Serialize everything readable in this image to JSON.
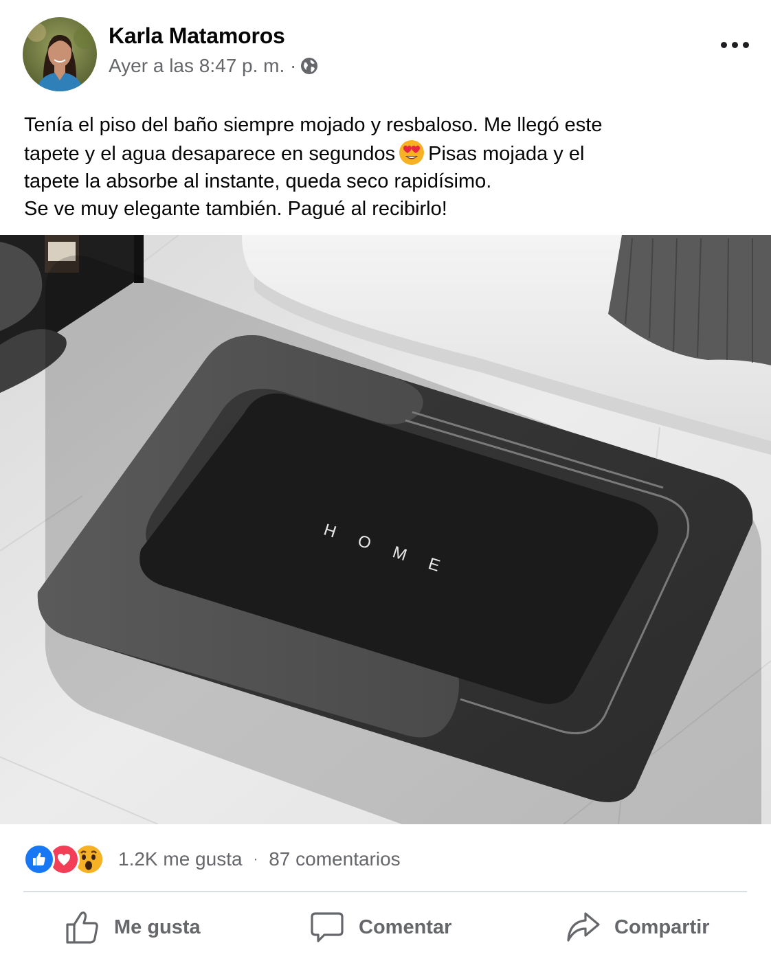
{
  "post": {
    "author_name": "Karla Matamoros",
    "time": "Ayer a las 8:47 p. m. ·",
    "text_lines": [
      "Tenía el piso del baño siempre mojado y resbaloso. Me llegó este",
      "tapete y el agua desaparece en segundos",
      "Pisas mojada y el",
      "tapete la absorbe al instante, queda seco rapidísimo.",
      "Se ve muy elegante también. Pagué al recibirlo!"
    ],
    "photo": {
      "mat_text": "H O M E"
    }
  },
  "reactions": {
    "icons": [
      "like-icon",
      "love-icon",
      "wow-icon"
    ],
    "likes": "1.2K me gusta",
    "separator": "·",
    "comments": "87 comentarios"
  },
  "actions": {
    "like": "Me gusta",
    "comment": "Comentar",
    "share": "Compartir"
  },
  "colors": {
    "like_blue": "#1877f2",
    "love_red": "#f33e58",
    "wow_yellow": "#f7b125",
    "secondary_text": "#65676b"
  }
}
